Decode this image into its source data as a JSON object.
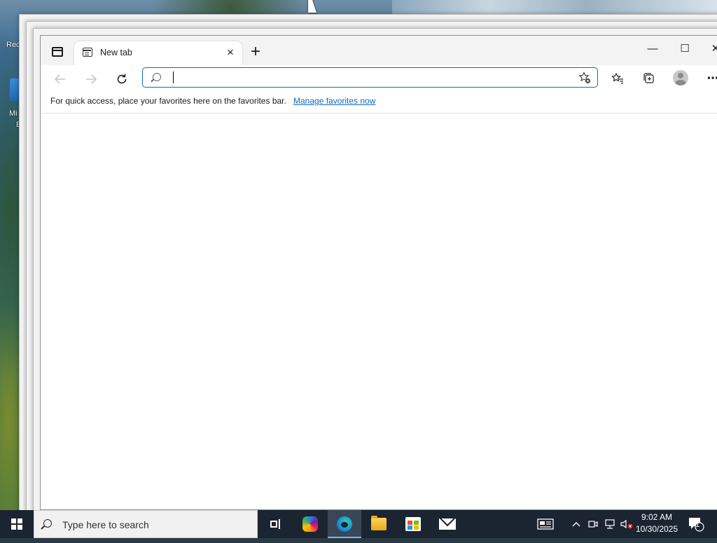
{
  "desktop": {
    "labels": [
      "Rec",
      "Mi",
      "E"
    ]
  },
  "browser": {
    "tab_title": "New tab",
    "address_placeholder": "",
    "address_value": "",
    "favorites_bar_text": "For quick access, place your favorites here on the favorites bar.",
    "favorites_bar_link": "Manage favorites now",
    "controls": {
      "minimize": "—",
      "maximize": "☐",
      "close": "✕",
      "new_tab": "+",
      "tab_close": "×",
      "more": "⋯"
    }
  },
  "taskbar": {
    "search_placeholder": "Type here to search",
    "time": "9:02 AM",
    "date": "10/30/2025",
    "notification_count": "1",
    "apps": [
      "task-view",
      "copilot",
      "microsoft-edge",
      "file-explorer",
      "microsoft-store",
      "mail"
    ]
  },
  "colors": {
    "accent": "#0f6cbd",
    "taskbar": "#1b2531",
    "titlebar": "#f3f3f3"
  }
}
